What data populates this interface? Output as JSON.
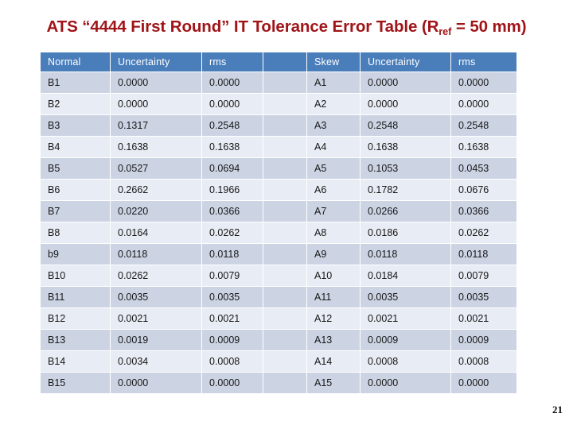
{
  "slide": {
    "title_prefix": "ATS “4444 First Round” IT Tolerance Error Table (R",
    "title_subscript": "ref",
    "title_suffix": " = 50 mm)",
    "page_number": "21",
    "title_color": "#a01418",
    "header_color": "#4a7ebb",
    "row_odd_color": "#ccd4e4",
    "row_even_color": "#e8ecf4"
  },
  "table": {
    "headers": [
      "Normal",
      "Uncertainty",
      "rms",
      "",
      "Skew",
      "Uncertainty",
      "rms"
    ],
    "rows": [
      [
        "B1",
        "0.0000",
        "0.0000",
        "",
        "A1",
        "0.0000",
        "0.0000"
      ],
      [
        "B2",
        "0.0000",
        "0.0000",
        "",
        "A2",
        "0.0000",
        "0.0000"
      ],
      [
        "B3",
        "0.1317",
        "0.2548",
        "",
        "A3",
        "0.2548",
        "0.2548"
      ],
      [
        "B4",
        "0.1638",
        "0.1638",
        "",
        "A4",
        "0.1638",
        "0.1638"
      ],
      [
        "B5",
        "0.0527",
        "0.0694",
        "",
        "A5",
        "0.1053",
        "0.0453"
      ],
      [
        "B6",
        "0.2662",
        "0.1966",
        "",
        "A6",
        "0.1782",
        "0.0676"
      ],
      [
        "B7",
        "0.0220",
        "0.0366",
        "",
        "A7",
        "0.0266",
        "0.0366"
      ],
      [
        "B8",
        "0.0164",
        "0.0262",
        "",
        "A8",
        "0.0186",
        "0.0262"
      ],
      [
        "b9",
        "0.0118",
        "0.0118",
        "",
        "A9",
        "0.0118",
        "0.0118"
      ],
      [
        "B10",
        "0.0262",
        "0.0079",
        "",
        "A10",
        "0.0184",
        "0.0079"
      ],
      [
        "B11",
        "0.0035",
        "0.0035",
        "",
        "A11",
        "0.0035",
        "0.0035"
      ],
      [
        "B12",
        "0.0021",
        "0.0021",
        "",
        "A12",
        "0.0021",
        "0.0021"
      ],
      [
        "B13",
        "0.0019",
        "0.0009",
        "",
        "A13",
        "0.0009",
        "0.0009"
      ],
      [
        "B14",
        "0.0034",
        "0.0008",
        "",
        "A14",
        "0.0008",
        "0.0008"
      ],
      [
        "B15",
        "0.0000",
        "0.0000",
        "",
        "A15",
        "0.0000",
        "0.0000"
      ]
    ]
  }
}
